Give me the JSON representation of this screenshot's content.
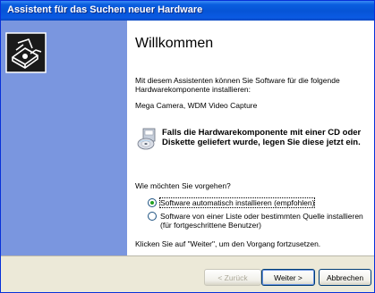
{
  "window": {
    "title": "Assistent für das Suchen neuer Hardware"
  },
  "main": {
    "heading": "Willkommen",
    "intro": "Mit diesem Assistenten können Sie Software für die folgende Hardwarekomponente installieren:",
    "device_name": "Mega Camera, WDM Video Capture",
    "cd_notice": "Falls die Hardwarekomponente mit einer CD oder Diskette geliefert wurde, legen Sie diese jetzt ein.",
    "question": "Wie möchten Sie vorgehen?",
    "options": [
      {
        "label": "Software automatisch installieren (empfohlen)",
        "selected": true
      },
      {
        "label": "Software von einer Liste oder bestimmten Quelle installieren (für fortgeschrittene Benutzer)",
        "selected": false
      }
    ],
    "continue_hint": "Klicken Sie auf \"Weiter\", um den Vorgang fortzusetzen."
  },
  "buttons": {
    "back": "< Zurück",
    "next": "Weiter >",
    "cancel": "Abbrechen"
  },
  "icons": {
    "wizard": "hardware-wizard-icon",
    "cd": "cd-disk-icon"
  },
  "colors": {
    "titlebar": "#0654d6",
    "side_panel": "#7a96df",
    "button_bar": "#ece9d8"
  }
}
